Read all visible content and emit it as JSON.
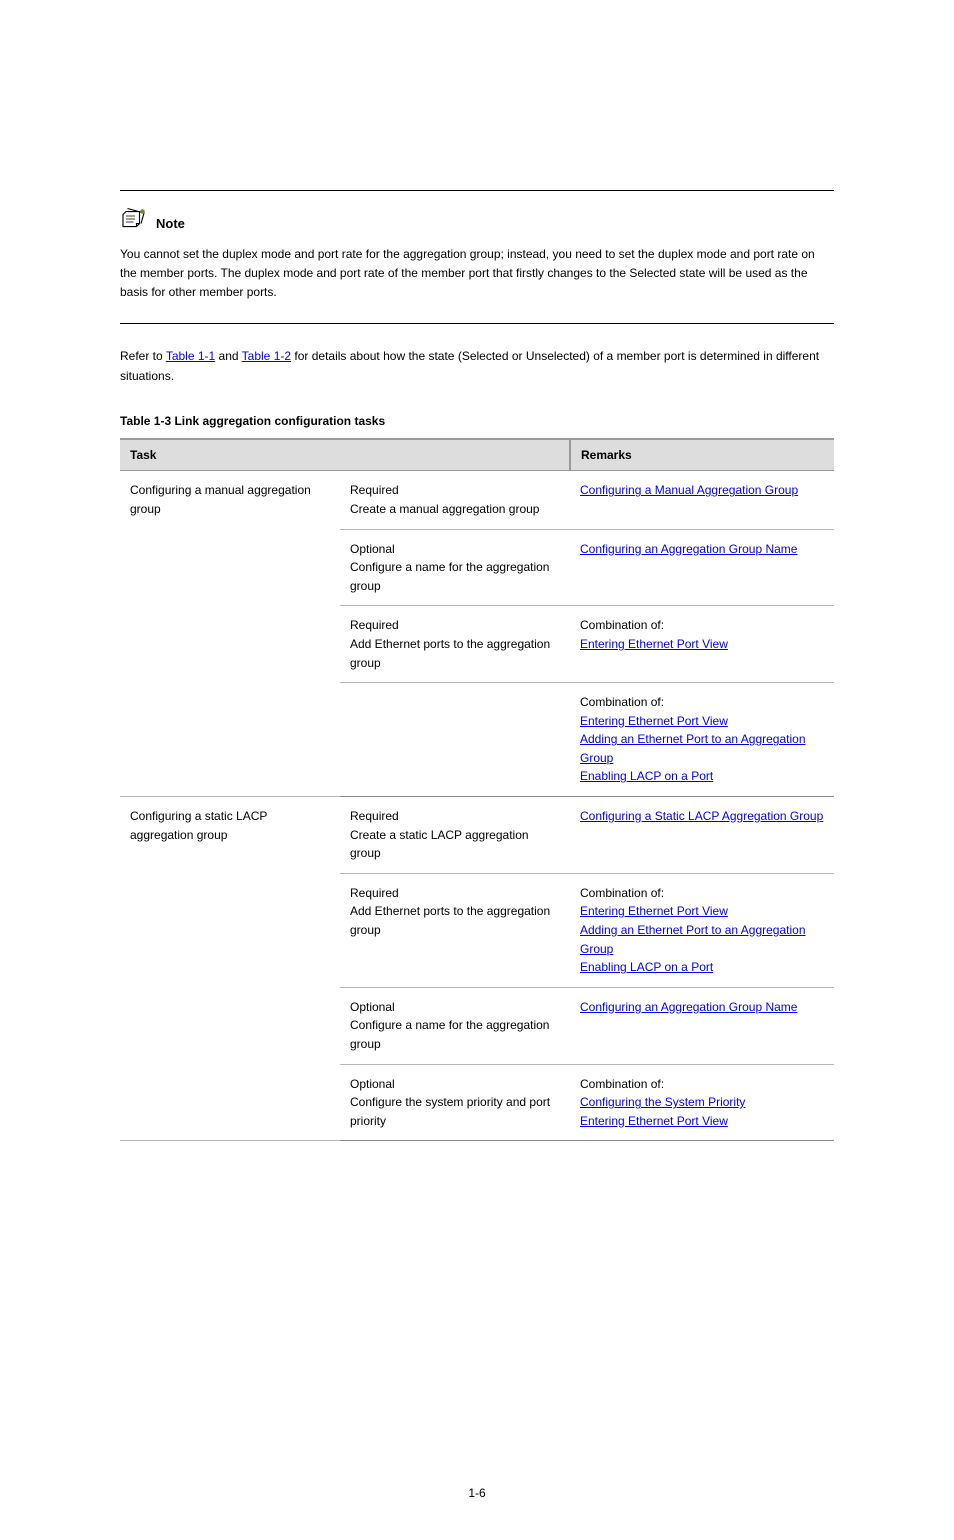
{
  "note": {
    "label": "Note",
    "body": "You cannot set the duplex mode and port rate for the aggregation group; instead, you need to set the duplex mode and port rate on the member ports. The duplex mode and port rate of the member port that firstly changes to the Selected state will be used as the basis for other member ports."
  },
  "lead": {
    "before_link1": "Refer to ",
    "link1": "Table 1-1",
    "between": " and ",
    "link2": "Table 1-2",
    "after": " for details about how the state (Selected or Unselected) of a member port is determined in different situations."
  },
  "table": {
    "caption": "Table 1-3 Link aggregation configuration tasks",
    "header": {
      "task": "Task",
      "remarks": "Remarks"
    },
    "rows": [
      {
        "group": "Configuring a manual aggregation group",
        "sub": "Required\nCreate a manual aggregation group",
        "ref_plain": "",
        "ref_links": [
          "Configuring a Manual Aggregation Group"
        ]
      },
      {
        "group": "",
        "sub": "Optional\nConfigure a name for the aggregation group",
        "ref_plain": "",
        "ref_links": [
          "Configuring an Aggregation Group Name"
        ]
      },
      {
        "group": "",
        "sub": "Required\nAdd Ethernet ports to the aggregation group",
        "ref_plain": "Combination of:",
        "ref_links": [
          "Entering Ethernet Port View"
        ]
      },
      {
        "group": "",
        "sub": "",
        "ref_plain": "Combination of:",
        "ref_links": [
          "Entering Ethernet Port View",
          "Adding an Ethernet Port to an Aggregation Group",
          "Enabling LACP on a Port"
        ]
      },
      {
        "group": "Configuring a static LACP aggregation group",
        "sub": "Required\nCreate a static LACP aggregation group",
        "ref_plain": "",
        "ref_links": [
          "Configuring a Static LACP Aggregation Group"
        ]
      },
      {
        "group": "",
        "sub": "Required\nAdd Ethernet ports to the aggregation group",
        "ref_plain": "Combination of:",
        "ref_links": [
          "Entering Ethernet Port View",
          "Adding an Ethernet Port to an Aggregation Group",
          "Enabling LACP on a Port"
        ]
      },
      {
        "group": "",
        "sub": "Optional\nConfigure a name for the aggregation group",
        "ref_plain": "",
        "ref_links": [
          "Configuring an Aggregation Group Name"
        ]
      },
      {
        "group": "",
        "sub": "Optional\nConfigure the system priority and port priority",
        "ref_plain": "Combination of:",
        "ref_links": [
          "Configuring the System Priority",
          "Entering Ethernet Port View"
        ]
      }
    ]
  },
  "page_number": "1-6"
}
